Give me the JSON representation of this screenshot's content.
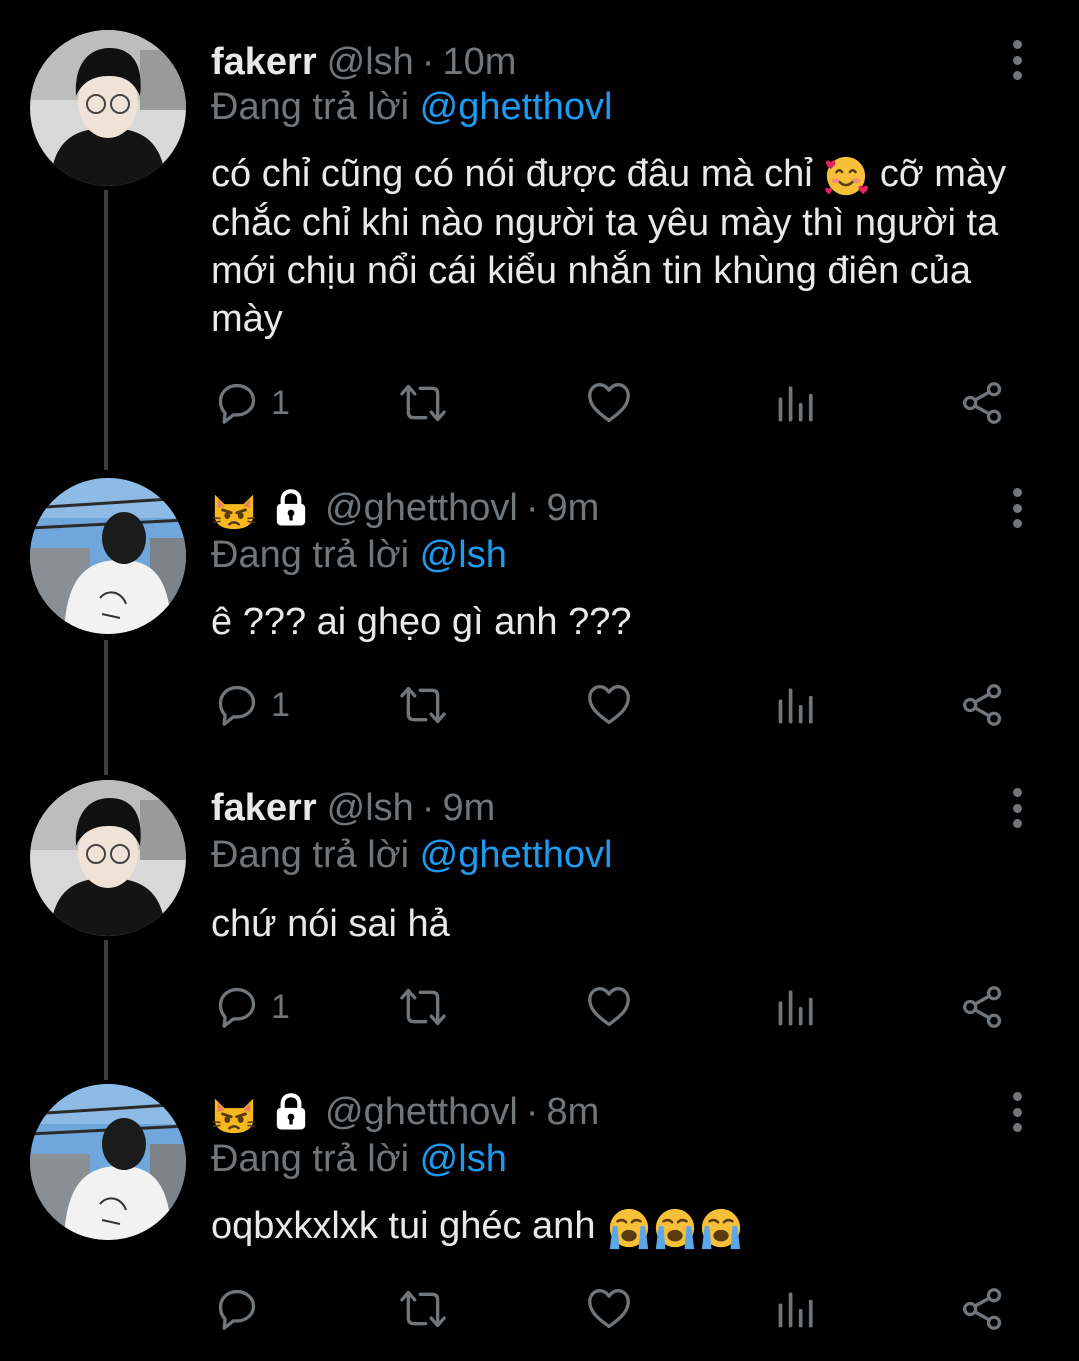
{
  "colors": {
    "background": "#000000",
    "text": "#e7e9ea",
    "muted": "#71767b",
    "mention": "#1d9bf0",
    "thread_line": "#3a3d41"
  },
  "tweets": [
    {
      "display_name": "fakerr",
      "display_emojis": [],
      "handle": "@lsh",
      "dot": "·",
      "time": "10m",
      "replying_prefix": "Đang trả lời",
      "replying_to": "@ghetthovl",
      "text_before_emoji": "có chỉ cũng có nói được đâu mà chỉ",
      "inline_emoji": "smiling-face-with-hearts",
      "text_after_emoji": "cỡ mày chắc chỉ khi nào người ta yêu mày thì người ta mới chịu nổi cái kiểu nhắn tin khùng điên của mày",
      "reply_count": "1"
    },
    {
      "display_name": "",
      "display_emojis": [
        "pouting-cat-face",
        "locked-icon"
      ],
      "handle": "@ghetthovl",
      "dot": "·",
      "time": "9m",
      "replying_prefix": "Đang trả lời",
      "replying_to": "@lsh",
      "text": "ê ??? ai ghẹo gì anh ???",
      "reply_count": "1"
    },
    {
      "display_name": "fakerr",
      "display_emojis": [],
      "handle": "@lsh",
      "dot": "·",
      "time": "9m",
      "replying_prefix": "Đang trả lời",
      "replying_to": "@ghetthovl",
      "text": "chứ nói sai hả",
      "reply_count": "1"
    },
    {
      "display_name": "",
      "display_emojis": [
        "pouting-cat-face",
        "locked-icon"
      ],
      "handle": "@ghetthovl",
      "dot": "·",
      "time": "8m",
      "replying_prefix": "Đang trả lời",
      "replying_to": "@lsh",
      "text": "oqbxkxlxk tui ghéc anh",
      "trailing_emojis": [
        "loudly-crying-face",
        "loudly-crying-face",
        "loudly-crying-face"
      ],
      "reply_count": ""
    }
  ],
  "action_icons": [
    "reply-icon",
    "retweet-icon",
    "like-icon",
    "views-icon",
    "share-icon"
  ]
}
